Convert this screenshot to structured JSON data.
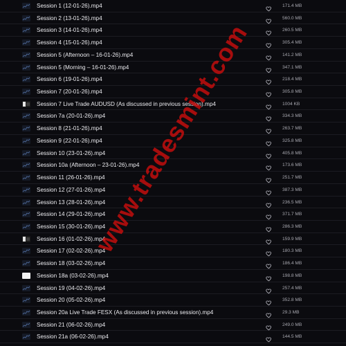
{
  "files": [
    {
      "name": "Session 1 (12-01-26).mp4",
      "size": "171.4 MB",
      "thumb": "chart"
    },
    {
      "name": "Session 2 (13-01-26).mp4",
      "size": "560.0 MB",
      "thumb": "chart"
    },
    {
      "name": "Session 3 (14-01-26).mp4",
      "size": "260.5 MB",
      "thumb": "chart"
    },
    {
      "name": "Session 4 (15-01-26).mp4",
      "size": "305.4 MB",
      "thumb": "chart"
    },
    {
      "name": "Session 5 (Afternoon – 16-01-26).mp4",
      "size": "141.2 MB",
      "thumb": "chart"
    },
    {
      "name": "Session 5 (Morning – 16-01-26).mp4",
      "size": "347.1 MB",
      "thumb": "chart"
    },
    {
      "name": "Session 6 (19-01-26).mp4",
      "size": "218.4 MB",
      "thumb": "chart"
    },
    {
      "name": "Session 7 (20-01-26).mp4",
      "size": "305.8 MB",
      "thumb": "chart"
    },
    {
      "name": "Session 7 Live Trade AUDUSD (As discussed in previous session).mp4",
      "size": "1004 KB",
      "thumb": "dark"
    },
    {
      "name": "Session 7a (20-01-26).mp4",
      "size": "334.3 MB",
      "thumb": "chart"
    },
    {
      "name": "Session 8 (21-01-26).mp4",
      "size": "263.7 MB",
      "thumb": "chart"
    },
    {
      "name": "Session 9 (22-01-26).mp4",
      "size": "325.8 MB",
      "thumb": "chart"
    },
    {
      "name": "Session 10 (23-01-26).mp4",
      "size": "405.8 MB",
      "thumb": "chart"
    },
    {
      "name": "Session 10a (Afternoon – 23-01-26).mp4",
      "size": "173.6 MB",
      "thumb": "chart"
    },
    {
      "name": "Session 11 (26-01-26).mp4",
      "size": "251.7 MB",
      "thumb": "chart"
    },
    {
      "name": "Session 12 (27-01-26).mp4",
      "size": "387.3 MB",
      "thumb": "chart"
    },
    {
      "name": "Session 13 (28-01-26).mp4",
      "size": "236.5 MB",
      "thumb": "chart"
    },
    {
      "name": "Session 14 (29-01-26).mp4",
      "size": "371.7 MB",
      "thumb": "chart"
    },
    {
      "name": "Session 15 (30-01-26).mp4",
      "size": "286.3 MB",
      "thumb": "chart"
    },
    {
      "name": "Session 16 (01-02-26).mp4",
      "size": "159.9 MB",
      "thumb": "dark"
    },
    {
      "name": "Session 17 (02-02-26).mp4",
      "size": "180.3 MB",
      "thumb": "chart"
    },
    {
      "name": "Session 18 (03-02-26).mp4",
      "size": "186.4 MB",
      "thumb": "chart"
    },
    {
      "name": "Session 18a (03-02-26).mp4",
      "size": "198.8 MB",
      "thumb": "white"
    },
    {
      "name": "Session 19 (04-02-26).mp4",
      "size": "257.4 MB",
      "thumb": "chart"
    },
    {
      "name": "Session 20 (05-02-26).mp4",
      "size": "352.8 MB",
      "thumb": "chart"
    },
    {
      "name": "Session 20a Live Trade FESX (As discussed in previous session).mp4",
      "size": "29.3 MB",
      "thumb": "chart"
    },
    {
      "name": "Session 21 (06-02-26).mp4",
      "size": "249.0 MB",
      "thumb": "chart"
    },
    {
      "name": "Session 21a (06-02-26).mp4",
      "size": "144.5 MB",
      "thumb": "chart"
    }
  ],
  "favorite_icon": "heart-outline-icon",
  "watermark": "www.tradesmint.com",
  "colors": {
    "background": "#0b0b0f",
    "text": "#ececf0",
    "size_text": "#a8a8b0",
    "row_divider": "#1c1c22",
    "watermark": "#c80e0e"
  }
}
